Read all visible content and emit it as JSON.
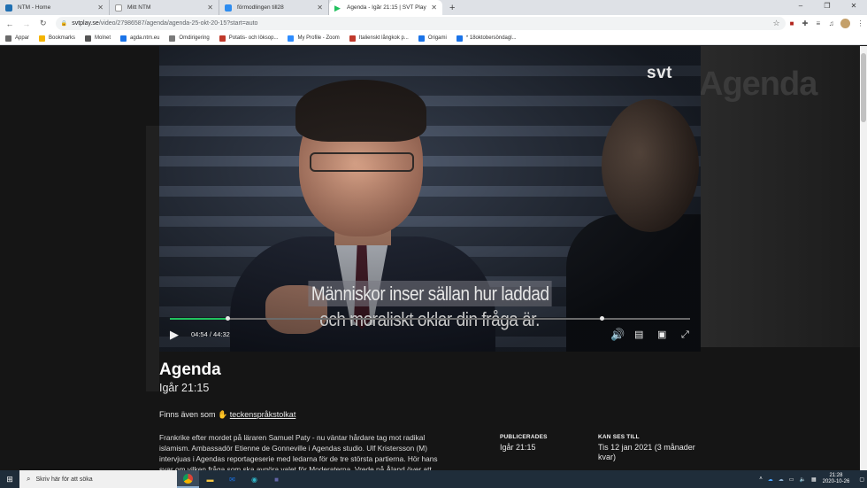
{
  "browser": {
    "tabs": [
      {
        "title": "NTM - Home",
        "favicon_color": "#1f6fb2",
        "active": false
      },
      {
        "title": "Mitt NTM",
        "favicon_color": "#ffffff",
        "active": false
      },
      {
        "title": "förmodlingen till28",
        "favicon_color": "#2d8cf0",
        "active": false
      },
      {
        "title": "Agenda - Igår 21:15 | SVT Play",
        "favicon_color": "#21c15e",
        "active": true
      }
    ],
    "new_tab_label": "+",
    "window_controls": [
      "–",
      "❐",
      "✕"
    ],
    "url_domain": "svtplay.se",
    "url_path": "/video/27986587/agenda/agenda-25-okt-20-15?start=auto",
    "bookmarks": [
      {
        "label": "Appar",
        "color": "#6a6a6a"
      },
      {
        "label": "Bookmarks",
        "color": "#f4b400"
      },
      {
        "label": "Molnet",
        "color": "#555555"
      },
      {
        "label": "agda.ntm.eu",
        "color": "#1a73e8"
      },
      {
        "label": "Omdirigering",
        "color": "#7a7a7a"
      },
      {
        "label": "Potatis- och löksop...",
        "color": "#c0392b"
      },
      {
        "label": "My Profile - Zoom",
        "color": "#2d8cff"
      },
      {
        "label": "Italienskt långkok p...",
        "color": "#c0392b"
      },
      {
        "label": "Origami",
        "color": "#1a73e8"
      },
      {
        "label": "* 18oktobersöndagl...",
        "color": "#1a73e8"
      }
    ]
  },
  "player": {
    "logo": "svt",
    "background_title": "Agenda",
    "subtitle_line1": "Människor inser sällan hur laddad",
    "subtitle_line2": "och moraliskt oklar din fråga är.",
    "time_display": "04:54 / 44:32",
    "progress_fraction": 0.11,
    "buffer_marker_fraction": 0.83,
    "accent_color": "#21c15e",
    "icons": {
      "play": "play-icon",
      "volume": "volume-icon",
      "subtitles": "subtitles-icon",
      "pip": "picture-in-picture-icon",
      "fullscreen": "fullscreen-icon"
    }
  },
  "episode": {
    "title": "Agenda",
    "air_time": "Igår 21:15",
    "also_prefix": "Finns även som",
    "also_link": "teckenspråkstolkat",
    "description": "Frankrike efter mordet på läraren Samuel Paty - nu väntar hårdare tag mot radikal islamism. Ambassadör Etienne de Gonneville i Agendas studio. Ulf Kristersson (M) intervjuas i Agendas reportageserie med ledarna för de tre största partierna. Hör hans svar om vilken fråga som ska avgöra valet för Moderaterna. Vrede på Åland över att",
    "published_label": "PUBLICERADES",
    "published_value": "Igår 21:15",
    "available_label": "KAN SES TILL",
    "available_value": "Tis 12 jan 2021 (3 månader kvar)"
  },
  "taskbar": {
    "search_placeholder": "Skriv här för att söka",
    "time": "21:28",
    "date": "2020-10-26"
  }
}
